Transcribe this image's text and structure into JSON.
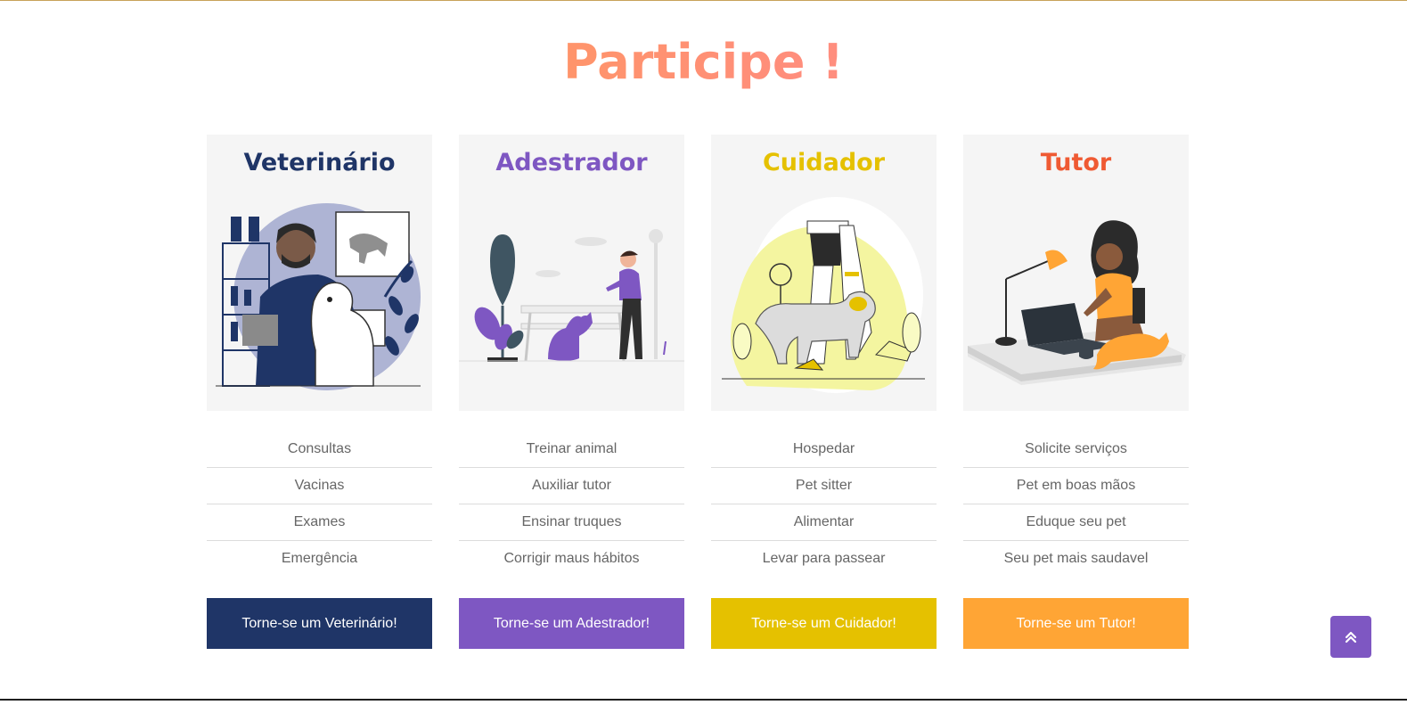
{
  "section_title": "Participe !",
  "cards": [
    {
      "title": "Veterinário",
      "color": "#1f3567",
      "features": [
        "Consultas",
        "Vacinas",
        "Exames",
        "Emergência"
      ],
      "button": "Torne-se um Veterinário!"
    },
    {
      "title": "Adestrador",
      "color": "#7e57c2",
      "features": [
        "Treinar animal",
        "Auxiliar tutor",
        "Ensinar truques",
        "Corrigir maus hábitos"
      ],
      "button": "Torne-se um Adestrador!"
    },
    {
      "title": "Cuidador",
      "color": "#e5c100",
      "features": [
        "Hospedar",
        "Pet sitter",
        "Alimentar",
        "Levar para passear"
      ],
      "button": "Torne-se um Cuidador!"
    },
    {
      "title": "Tutor",
      "color": "#ef5a33",
      "button_color": "#ffa535",
      "features": [
        "Solicite serviços",
        "Pet em boas mãos",
        "Eduque seu pet",
        "Seu pet mais saudavel"
      ],
      "button": "Torne-se um Tutor!"
    }
  ],
  "back_to_top": {
    "icon": "double-chevron-up-icon",
    "color": "#7e57c2"
  }
}
